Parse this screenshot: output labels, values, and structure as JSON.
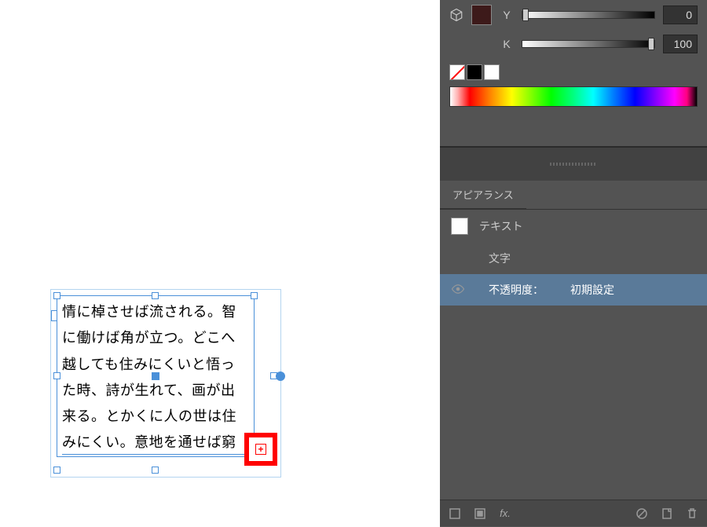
{
  "canvas": {
    "text_content": "情に棹させば流される。智に働けば角が立つ。どこへ越しても住みにくいと悟った時、詩が生れて、画が出来る。とかくに人の世は住みにくい。意地を通せば窮",
    "overflow_marker": "⊞"
  },
  "color_panel": {
    "slider_y": {
      "label": "Y",
      "value": "0"
    },
    "slider_k": {
      "label": "K",
      "value": "100"
    }
  },
  "appearance_panel": {
    "tab_label": "アピアランス",
    "text_label": "テキスト",
    "char_label": "文字",
    "opacity_label": "不透明度：",
    "opacity_value": "初期設定"
  }
}
